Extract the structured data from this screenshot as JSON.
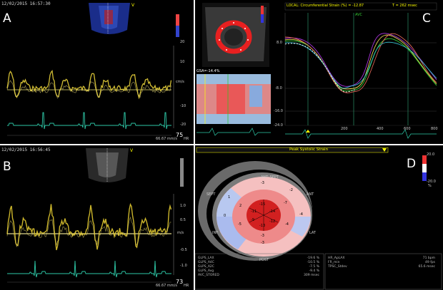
{
  "panel_a": {
    "label": "A",
    "timestamp": "12/02/2015 16:57:30",
    "hr_value": "75",
    "hr_label": "HR",
    "sweep": "66.67 mm/s",
    "unit": "cm/s",
    "scale": [
      "20",
      "10",
      "-10",
      "-20"
    ]
  },
  "panel_b": {
    "label": "B",
    "timestamp": "12/02/2015 16:56:45",
    "hr_value": "73",
    "hr_label": "HR",
    "sweep": "66.67 mm/s",
    "unit": "m/s",
    "scale": [
      "1.0",
      "0.5",
      "-0.5",
      "-1.0"
    ]
  },
  "panel_c": {
    "label": "C",
    "header": "LOCAL: Circumferential Strain (%) = -12.87",
    "time_readout": "T = 262 msec",
    "avc": "AVC",
    "gsa": "GSA=-14.4%",
    "y_ticks": [
      "8.0",
      "-8.0",
      "-16.0",
      "-24.0"
    ],
    "x_ticks": [
      "200",
      "400",
      "600",
      "800"
    ]
  },
  "panel_d": {
    "label": "D",
    "title": "Peak Systolic Strain",
    "bar_top": "20.0",
    "bar_bottom": "-20.0",
    "bar_unit": "%",
    "segment_labels": [
      "ANT_SEPT",
      "ANT",
      "LAT",
      "POST",
      "INF",
      "SEPT"
    ],
    "outer_values": [
      "-3",
      "-2",
      "-4",
      "-3",
      "0",
      "1",
      "-7",
      "-4",
      "-3",
      "-5",
      "2"
    ],
    "inner_values": [
      "-15",
      "-14",
      "-12",
      "-13",
      "-9",
      "-11"
    ],
    "left_table": [
      [
        "GLPS_LAX",
        "-19.6 %"
      ],
      [
        "GLPS_A4C",
        "-10.5 %"
      ],
      [
        "GLPS_A2C",
        "-7.5 %"
      ],
      [
        "GLPS_Avg",
        "-9.4 %"
      ],
      [
        "AVC_STORED",
        "309 msec"
      ]
    ],
    "right_table": [
      [
        "HR_ApLAX",
        "71 bpm"
      ],
      [
        "FR_min",
        "49 fps"
      ],
      [
        "TPSC_Stdev",
        "65.6 msec"
      ]
    ]
  }
}
